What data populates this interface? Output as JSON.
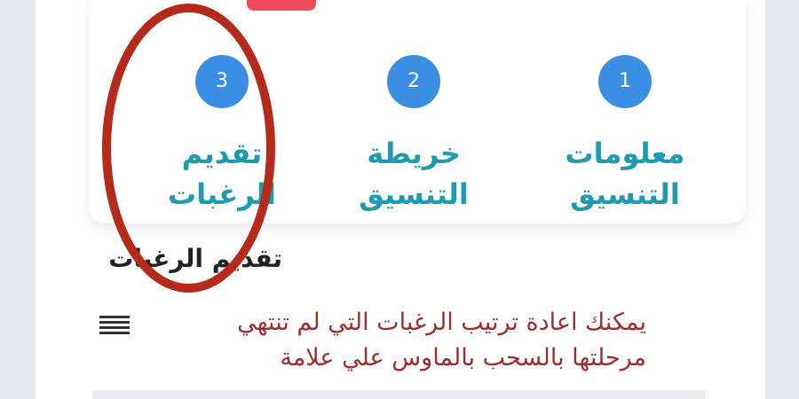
{
  "steps": [
    {
      "number": "1",
      "label_line1": "معلومات",
      "label_line2": "التنسيق"
    },
    {
      "number": "2",
      "label_line1": "خريطة",
      "label_line2": "التنسيق"
    },
    {
      "number": "3",
      "label_line1": "تقديم",
      "label_line2": "الرغبات"
    }
  ],
  "section": {
    "title": "تقديم الرغبات"
  },
  "hint": {
    "line1": "يمكنك اعادة ترتيب الرغبات التي لم تنتهي",
    "line2": "مرحلتها بالسحب بالماوس علي علامة",
    "color": "#9c2e2e"
  },
  "icons": {
    "drag_handle": "drag-handle-icon"
  },
  "colors": {
    "step_circle": "#3a8fe4",
    "step_label": "#1f9bb0",
    "highlight": "#b52a1a",
    "accent_tab": "#ef4b5d"
  }
}
